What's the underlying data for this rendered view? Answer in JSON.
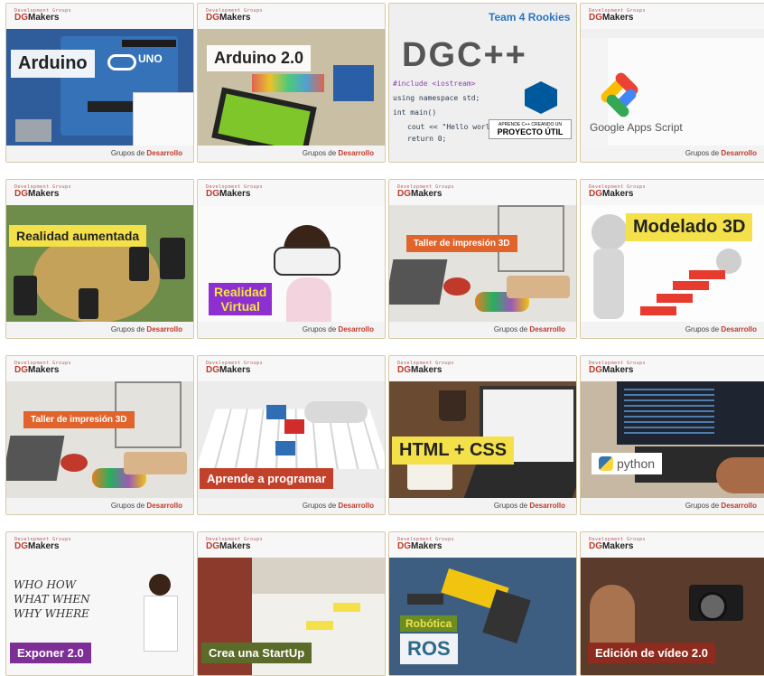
{
  "brand": {
    "tagline": "Development Groups",
    "name_a": "DG",
    "name_b": "Makers",
    "footer_prefix": "Grupos de",
    "footer_strong": "Desarrollo"
  },
  "cards": [
    {
      "title": "Arduino",
      "extra": "UNO"
    },
    {
      "title": "Arduino 2.0"
    },
    {
      "title": "DGC++",
      "team": "Team 4 Rookies",
      "code1": "#include <iostream>",
      "code2": "using namespace std;",
      "code3": "int main()",
      "code4": "cout << \"Hello world!\"",
      "code5": "return 0;",
      "badge1": "APRENDE C++ CREANDO UN",
      "badge2": "PROYECTO ÚTIL"
    },
    {
      "title": "Google Apps Script"
    },
    {
      "title": "Realidad aumentada"
    },
    {
      "title1": "Realidad",
      "title2": "Virtual"
    },
    {
      "title": "Taller de impresión 3D"
    },
    {
      "title": "Modelado 3D"
    },
    {
      "title": "Taller de impresión 3D"
    },
    {
      "title": "Aprende a programar"
    },
    {
      "title": "HTML + CSS"
    },
    {
      "title": "python"
    },
    {
      "title": "Exponer 2.0",
      "board": "WHO HOW WHAT WHEN WHY WHERE"
    },
    {
      "title": "Crea una StartUp"
    },
    {
      "title1": "Robótica",
      "title2": "ROS"
    },
    {
      "title": "Edición de vídeo 2.0"
    }
  ]
}
